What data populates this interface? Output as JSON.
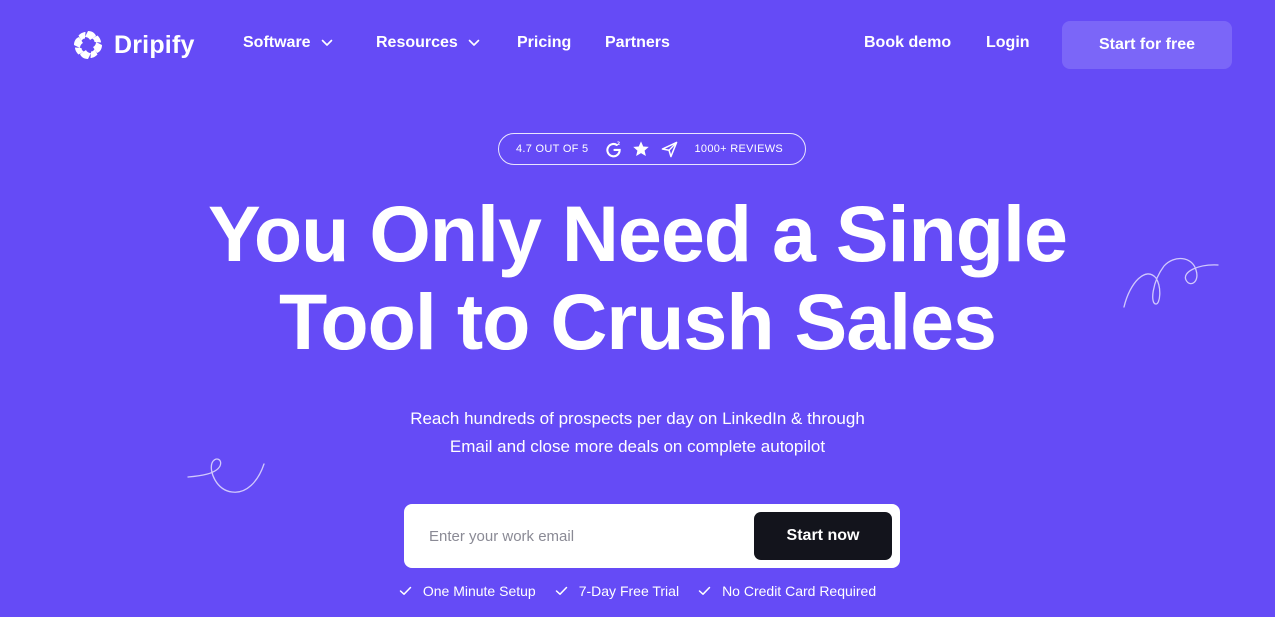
{
  "brand": {
    "name": "Dripify",
    "logo_icon": "dripify-logo-icon"
  },
  "nav": {
    "items": [
      {
        "label": "Software",
        "has_dropdown": true
      },
      {
        "label": "Resources",
        "has_dropdown": true
      },
      {
        "label": "Pricing",
        "has_dropdown": false
      },
      {
        "label": "Partners",
        "has_dropdown": false
      }
    ],
    "book_demo": "Book demo",
    "login": "Login",
    "start_free": "Start for free"
  },
  "rating": {
    "score_text": "4.7 OUT OF 5",
    "icons": [
      "g2-icon",
      "star-icon",
      "capterra-icon"
    ],
    "reviews_text": "1000+ REVIEWS"
  },
  "hero": {
    "headline_lines": [
      "You Only Need a Single",
      "Tool to Crush Sales"
    ],
    "subtitle_lines": [
      "Reach hundreds of prospects per day on LinkedIn & through",
      "Email and close more deals on complete autopilot"
    ]
  },
  "signup": {
    "email_placeholder": "Enter your work email",
    "email_value": "",
    "submit_label": "Start now"
  },
  "features": [
    "One Minute Setup",
    "7-Day Free Trial",
    "No Credit Card Required"
  ],
  "colors": {
    "background": "#654bf6",
    "secondary_button": "#7b66f8",
    "primary_button": "#13141c",
    "text": "#ffffff"
  }
}
